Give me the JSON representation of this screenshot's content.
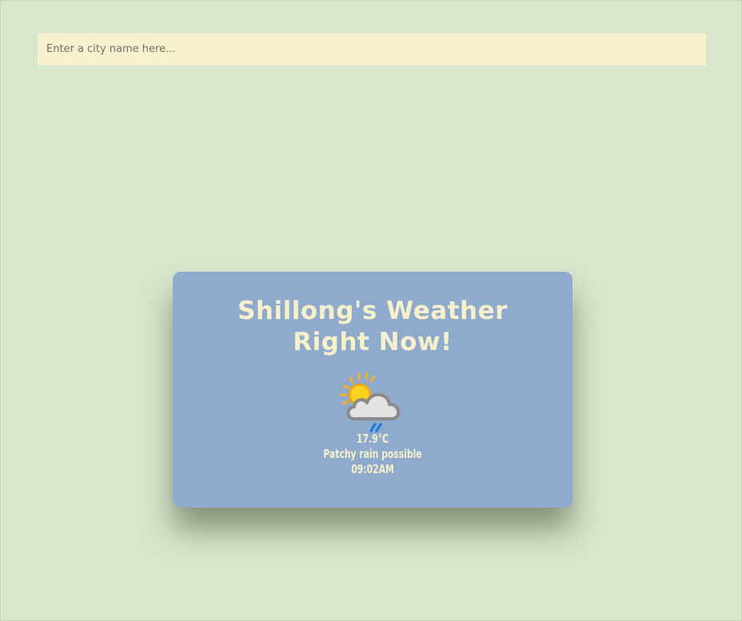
{
  "search": {
    "placeholder": "Enter a city name here...",
    "value": ""
  },
  "card": {
    "title": "Shillong's Weather Right Now!",
    "icon": "sun-cloud-rain-icon",
    "temperature": "17.9°C",
    "condition": "Patchy rain possible",
    "time": "09:02AM"
  },
  "colors": {
    "background": "#d9e5cc",
    "input_background": "#f7f2cd",
    "card_background": "#8eabce",
    "card_text": "#f7f0c8"
  }
}
